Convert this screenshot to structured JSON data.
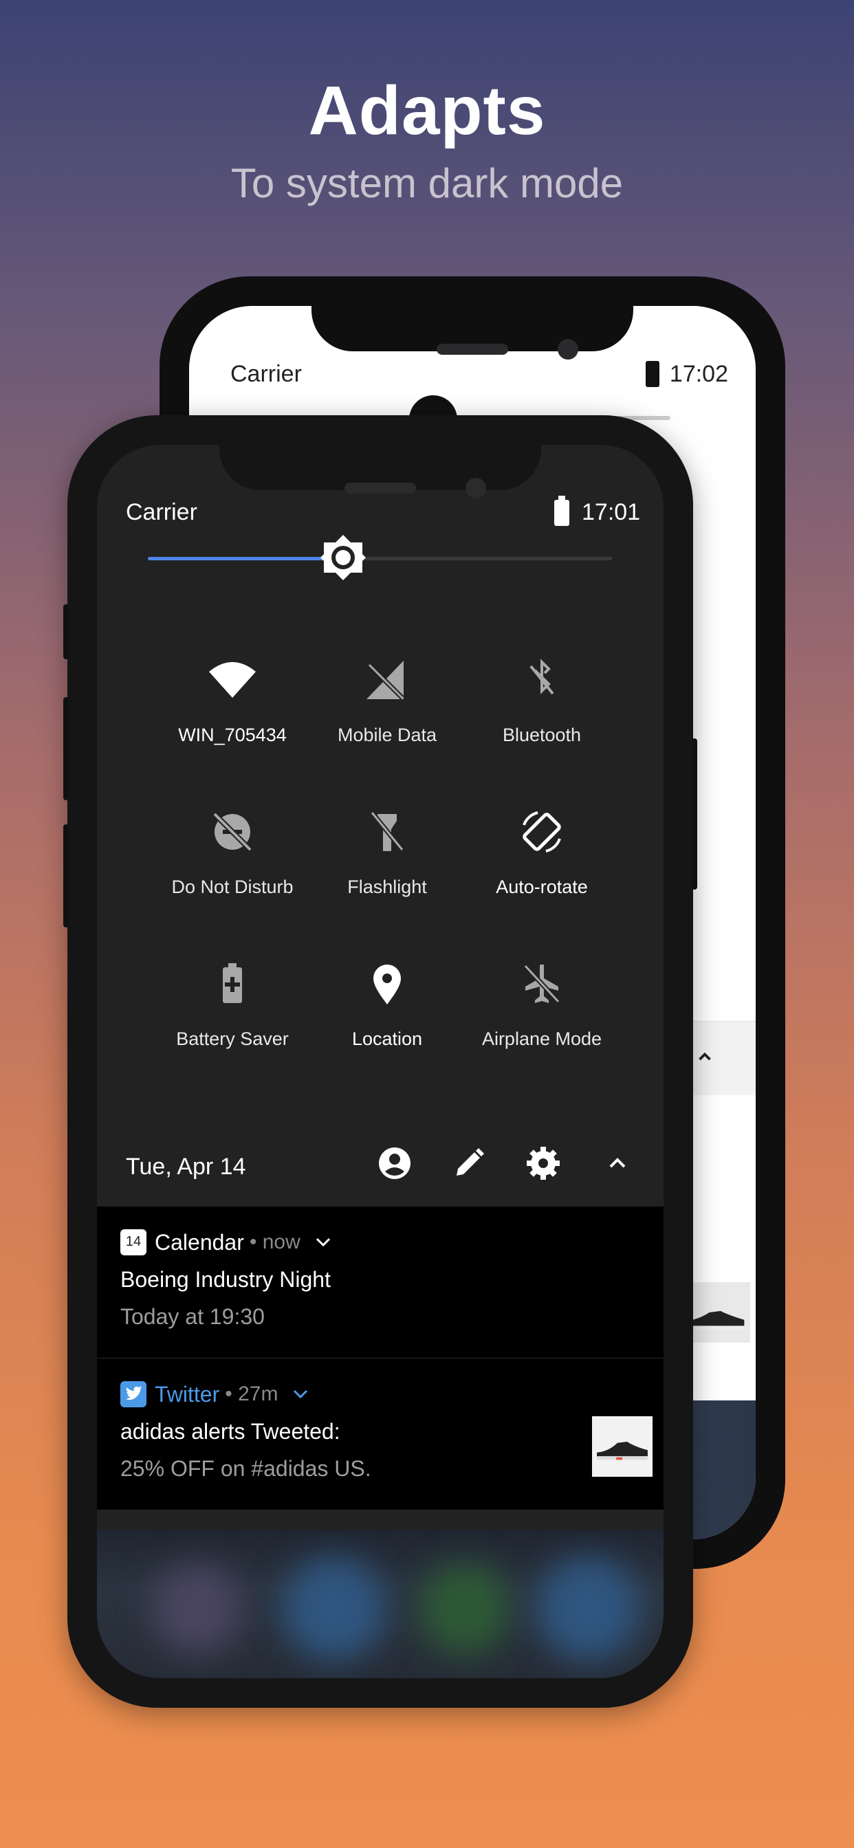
{
  "headline": "Adapts",
  "subheadline": "To system dark mode",
  "back_phone": {
    "carrier": "Carrier",
    "time": "17:02"
  },
  "status_bar": {
    "carrier": "Carrier",
    "time": "17:01"
  },
  "brightness": {
    "level": 0.42,
    "accent_color": "#4d86e8"
  },
  "quick_settings": [
    {
      "label": "WIN_705434",
      "icon": "wifi-icon",
      "state": "on"
    },
    {
      "label": "Mobile Data",
      "icon": "mobile-data-off-icon",
      "state": "off"
    },
    {
      "label": "Bluetooth",
      "icon": "bluetooth-off-icon",
      "state": "off"
    },
    {
      "label": "Do Not Disturb",
      "icon": "do-not-disturb-off-icon",
      "state": "off"
    },
    {
      "label": "Flashlight",
      "icon": "flashlight-off-icon",
      "state": "off"
    },
    {
      "label": "Auto-rotate",
      "icon": "auto-rotate-icon",
      "state": "on"
    },
    {
      "label": "Battery Saver",
      "icon": "battery-saver-icon",
      "state": "off"
    },
    {
      "label": "Location",
      "icon": "location-icon",
      "state": "on"
    },
    {
      "label": "Airplane Mode",
      "icon": "airplane-off-icon",
      "state": "off"
    }
  ],
  "footer": {
    "date": "Tue, Apr 14",
    "actions": [
      "account-icon",
      "edit-icon",
      "settings-icon",
      "collapse-icon"
    ]
  },
  "notifications": [
    {
      "app": "Calendar",
      "app_icon_text": "14",
      "time": "• now",
      "title": "Boeing Industry Night",
      "body": "Today at 19:30",
      "app_color": "#ffffff"
    },
    {
      "app": "Twitter",
      "time": "• 27m",
      "title": "adidas alerts Tweeted:",
      "body": "25% OFF on #adidas US.",
      "app_color": "#4b9ae8"
    }
  ]
}
